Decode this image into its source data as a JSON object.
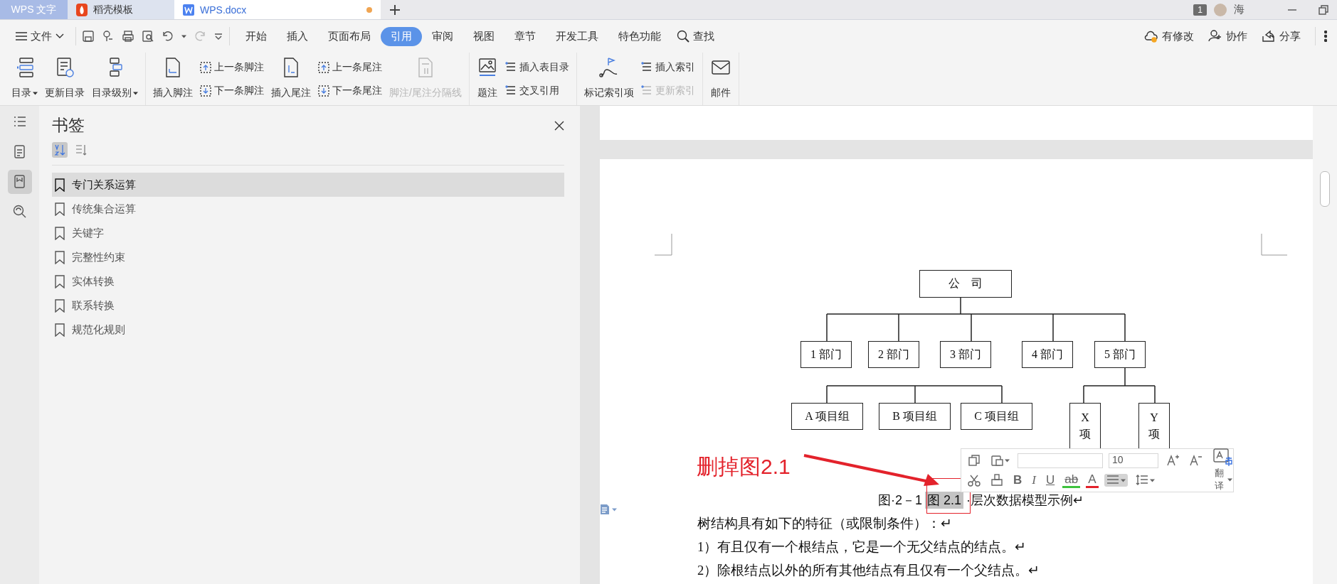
{
  "tabs": [
    {
      "kind": "app",
      "label": "WPS 文字",
      "selected": false,
      "modified": false
    },
    {
      "kind": "template",
      "label": "稻壳模板",
      "selected": false,
      "modified": false
    },
    {
      "kind": "doc",
      "label": "WPS.docx",
      "selected": true,
      "modified": true
    }
  ],
  "account": {
    "badge": "1",
    "user": "海"
  },
  "menu": {
    "file": "文件",
    "tabs": [
      {
        "label": "开始",
        "selected": false
      },
      {
        "label": "插入",
        "selected": false
      },
      {
        "label": "页面布局",
        "selected": false
      },
      {
        "label": "引用",
        "selected": true
      },
      {
        "label": "审阅",
        "selected": false
      },
      {
        "label": "视图",
        "selected": false
      },
      {
        "label": "章节",
        "selected": false
      },
      {
        "label": "开发工具",
        "selected": false
      },
      {
        "label": "特色功能",
        "selected": false
      }
    ],
    "search": "查找",
    "actions": [
      {
        "label": "有修改"
      },
      {
        "label": "协作"
      },
      {
        "label": "分享"
      }
    ]
  },
  "ribbon": {
    "groups": [
      {
        "items": [
          {
            "kind": "large",
            "label": "目录",
            "dropdown": true,
            "disabled": false
          },
          {
            "kind": "large",
            "label": "更新目录",
            "dropdown": false,
            "disabled": false
          },
          {
            "kind": "large",
            "label": "目录级别",
            "dropdown": true,
            "disabled": false
          }
        ]
      },
      {
        "items": [
          {
            "kind": "large",
            "label": "插入脚注",
            "dropdown": false,
            "disabled": false
          },
          {
            "kind": "pair",
            "items": [
              {
                "label": "上一条脚注",
                "disabled": false
              },
              {
                "label": "下一条脚注",
                "disabled": false
              }
            ]
          },
          {
            "kind": "large",
            "label": "插入尾注",
            "dropdown": false,
            "disabled": false
          },
          {
            "kind": "pair",
            "items": [
              {
                "label": "上一条尾注",
                "disabled": false
              },
              {
                "label": "下一条尾注",
                "disabled": false
              }
            ]
          },
          {
            "kind": "large",
            "label": "脚注/尾注分隔线",
            "dropdown": false,
            "disabled": true
          }
        ]
      },
      {
        "items": [
          {
            "kind": "large",
            "label": "题注",
            "dropdown": false,
            "disabled": false
          },
          {
            "kind": "pair",
            "items": [
              {
                "label": "插入表目录",
                "disabled": false
              },
              {
                "label": "交叉引用",
                "disabled": false
              }
            ]
          }
        ]
      },
      {
        "items": [
          {
            "kind": "large",
            "label": "标记索引项",
            "dropdown": false,
            "disabled": false
          },
          {
            "kind": "pair",
            "items": [
              {
                "label": "插入索引",
                "disabled": false
              },
              {
                "label": "更新索引",
                "disabled": true
              }
            ]
          }
        ]
      },
      {
        "items": [
          {
            "kind": "large",
            "label": "邮件",
            "dropdown": false,
            "disabled": false
          }
        ]
      }
    ]
  },
  "sidebar": {
    "rail": [
      {
        "selected": false
      },
      {
        "selected": false
      },
      {
        "selected": true
      },
      {
        "selected": false
      }
    ],
    "title": "书签",
    "sort": [
      {
        "selected": true
      },
      {
        "selected": false
      }
    ],
    "items": [
      {
        "label": "专门关系运算",
        "selected": true
      },
      {
        "label": "传统集合运算",
        "selected": false
      },
      {
        "label": "关键字",
        "selected": false
      },
      {
        "label": "完整性约束",
        "selected": false
      },
      {
        "label": "实体转换",
        "selected": false
      },
      {
        "label": "联系转换",
        "selected": false
      },
      {
        "label": "规范化规则",
        "selected": false
      }
    ]
  },
  "document": {
    "diagram": {
      "root": "公　司",
      "departments": [
        "1 部门",
        "2 部门",
        "3 部门",
        "4 部门",
        "5 部门"
      ],
      "groups": [
        "A 项目组",
        "B 项目组",
        "C 项目组"
      ],
      "sub_groups": [
        "X项",
        "Y项"
      ]
    },
    "caption": {
      "prefix": "图·2－1",
      "selected": "图 2.1",
      "suffix": "·层次数据模型示例↵"
    },
    "paragraphs": [
      "树结构具有如下的特征（或限制条件）：↵",
      "1）有且仅有一个根结点，它是一个无父结点的结点。↵",
      "2）除根结点以外的所有其他结点有且仅有一个父结点。↵"
    ],
    "annotation": "删掉图2.1",
    "float_toolbar": {
      "font_size": "10",
      "bold": "B",
      "italic": "I",
      "underline": "U",
      "strike": "ab",
      "font_color": "A",
      "translate": "翻译"
    }
  }
}
